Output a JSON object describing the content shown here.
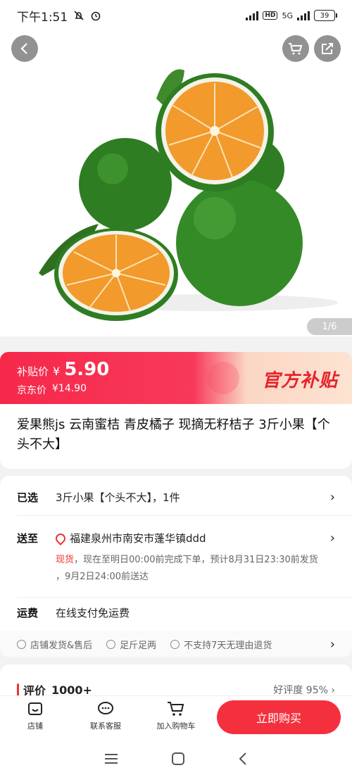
{
  "status_bar": {
    "time": "下午1:51",
    "network": "5G",
    "hd": "HD",
    "battery": "39"
  },
  "header": {
    "back_icon": "chevron-left-icon",
    "cart_icon": "cart-icon",
    "share_icon": "share-icon"
  },
  "gallery": {
    "counter": "1/6"
  },
  "price": {
    "subsidy_label": "补贴价",
    "currency": "¥",
    "subsidy_value": "5.90",
    "jd_label": "京东价",
    "jd_value": "¥14.90",
    "badge_text": "官方补贴"
  },
  "product": {
    "title": "爱果熊js 云南蜜桔  青皮橘子 现摘无籽桔子 3斤小果【个头不大】"
  },
  "selected": {
    "label": "已选",
    "value": "3斤小果【个头不大】，1件"
  },
  "delivery": {
    "label": "送至",
    "address": "福建泉州市南安市蓬华镇ddd",
    "stock": "现货",
    "schedule_line1": "，现在至明日00:00前完成下单，预计8月31日23:30前发货",
    "schedule_line2": "，9月2日24:00前送达"
  },
  "freight": {
    "label": "运费",
    "value": "在线支付免运费"
  },
  "guarantees": [
    {
      "label": "店铺发货&售后"
    },
    {
      "label": "足斤足两"
    },
    {
      "label": "不支持7天无理由退货"
    }
  ],
  "reviews": {
    "title": "评价",
    "count": "1000+",
    "rating": "好评度 95%",
    "arrow": "›"
  },
  "bottom_bar": {
    "shop": "店铺",
    "service": "联系客服",
    "add_cart": "加入购物车",
    "buy_now": "立即购买"
  },
  "colors": {
    "accent": "#f5303e",
    "price_red": "#e5232b"
  }
}
